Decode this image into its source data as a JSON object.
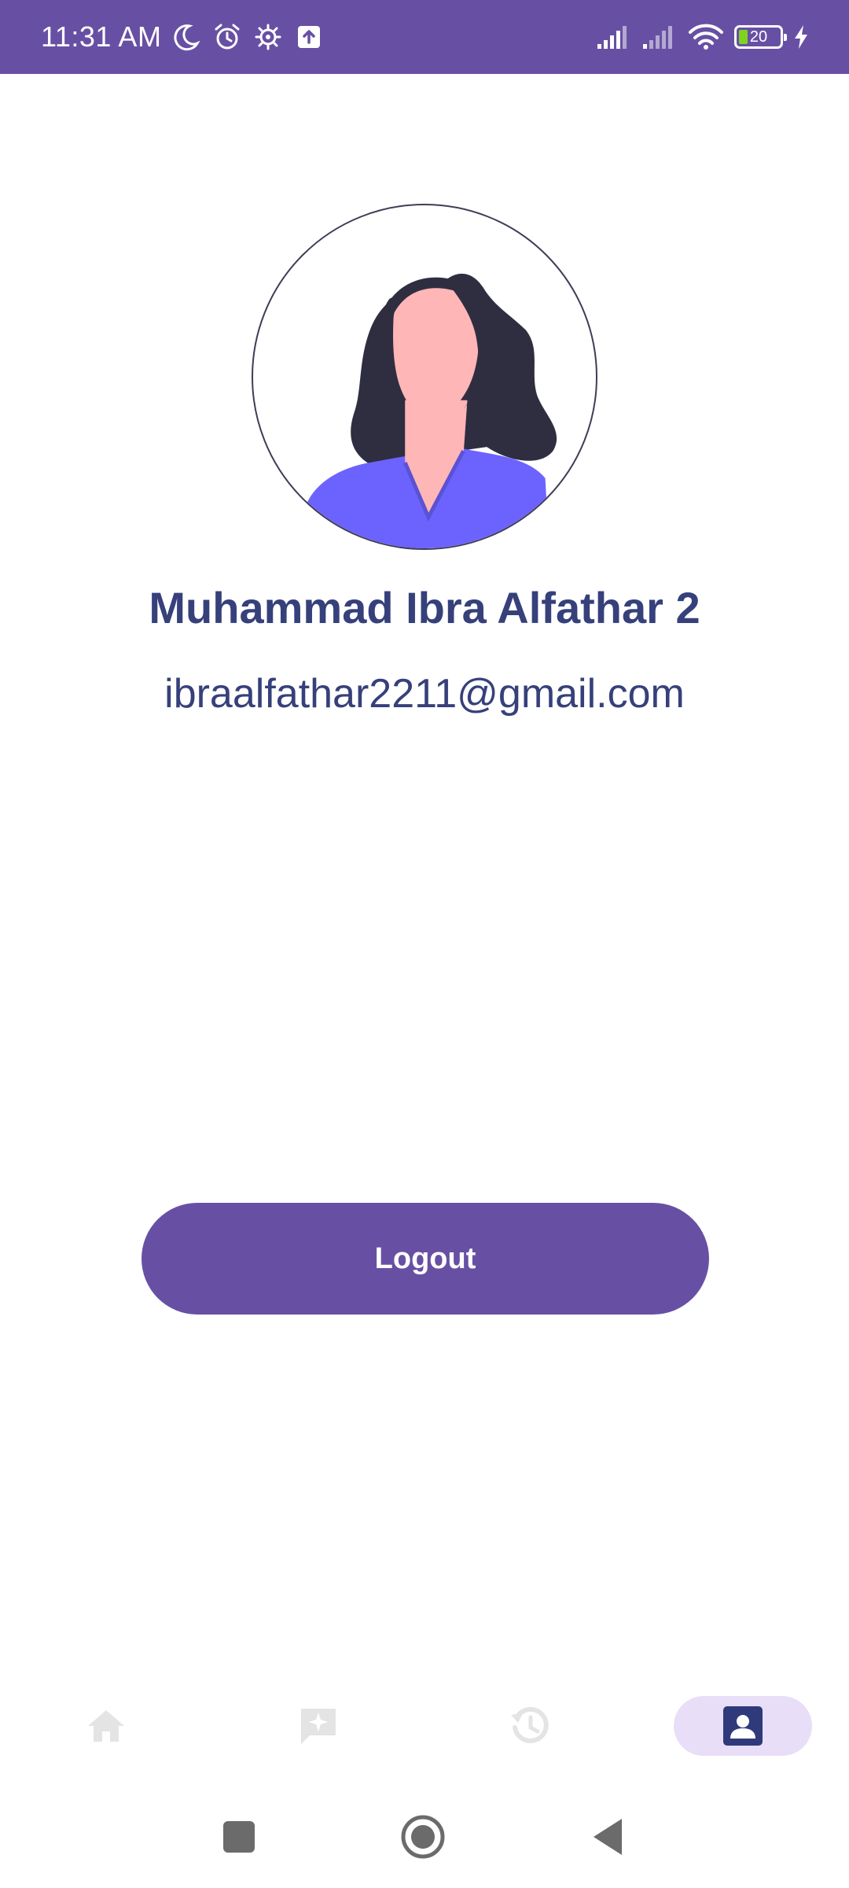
{
  "status_bar": {
    "time": "11:31 AM",
    "battery_level": "20",
    "battery_fraction": 0.2,
    "left_icons": [
      "moon-icon",
      "alarm-icon",
      "settings-icon",
      "upload-icon"
    ],
    "right_icons": [
      "signal-icon",
      "signal-icon",
      "wifi-icon",
      "battery-icon",
      "charging-icon"
    ],
    "background_color": "#6750a4"
  },
  "profile": {
    "avatar_icon": "woman-avatar-illustration",
    "name": "Muhammad Ibra Alfathar 2",
    "email": "ibraalfathar2211@gmail.com",
    "text_color": "#36407a"
  },
  "actions": {
    "logout_label": "Logout",
    "button_color": "#6750a4"
  },
  "bottom_nav": {
    "items": [
      {
        "icon": "home-icon",
        "active": false
      },
      {
        "icon": "chat-sparkle-icon",
        "active": false
      },
      {
        "icon": "history-icon",
        "active": false
      },
      {
        "icon": "profile-icon",
        "active": true
      }
    ],
    "active_indicator_color": "#e8def8"
  },
  "system_nav": [
    "recents-button",
    "home-button",
    "back-button"
  ]
}
